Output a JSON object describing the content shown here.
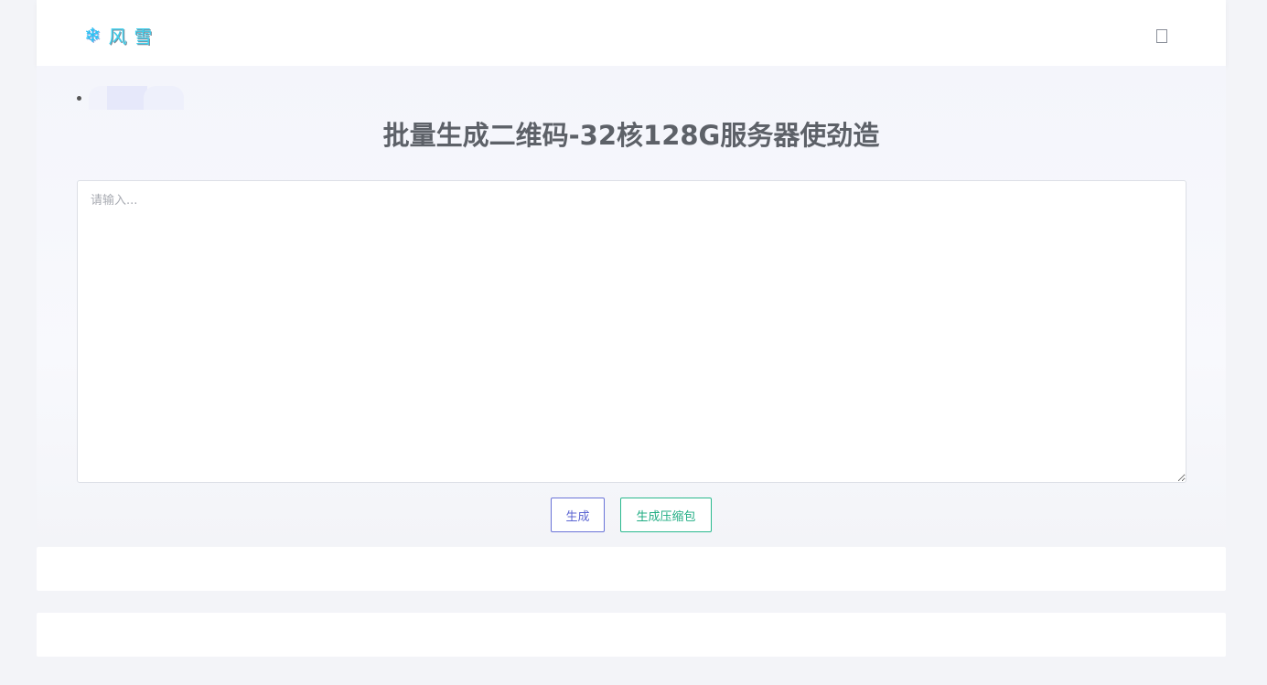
{
  "header": {
    "logo_icon": "❄",
    "logo_text": "风雪",
    "menu_icon": "menu-toggle-icon"
  },
  "main": {
    "title": "批量生成二维码-32核128G服务器使劲造",
    "input": {
      "value": "",
      "placeholder": "请输入..."
    },
    "buttons": {
      "generate": "生成",
      "zip": "生成压缩包"
    }
  },
  "colors": {
    "background": "#f3f4f8",
    "logo": "#3fd1ee",
    "generate_button": "#5c66d2",
    "zip_button": "#20ad83",
    "title": "#5d6168"
  }
}
